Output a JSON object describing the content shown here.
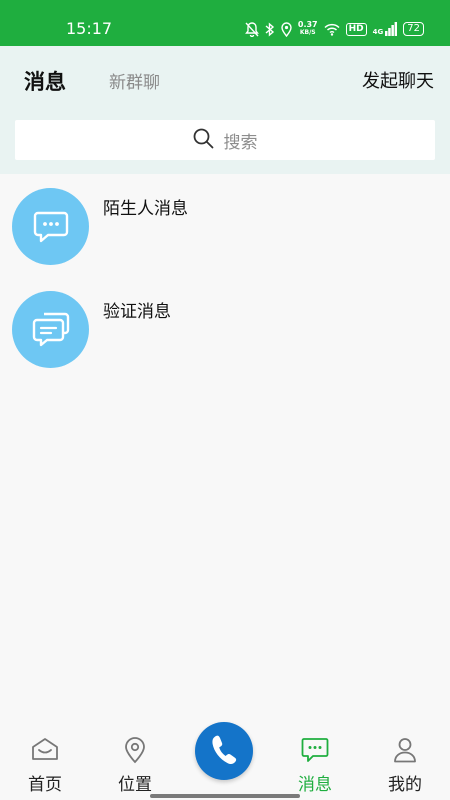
{
  "status_bar": {
    "time": "15:17",
    "speed_value": "0.37",
    "speed_unit": "KB/S",
    "hd": "HD",
    "signal": "4G",
    "battery": "72",
    "bg_color": "#1fae3f"
  },
  "header": {
    "tab_active": "消息",
    "tab_inactive": "新群聊",
    "start_chat": "发起聊天",
    "bg_color": "#e9f3f2"
  },
  "search": {
    "placeholder": "搜索",
    "icon": "search-icon"
  },
  "messages": [
    {
      "title": "陌生人消息",
      "icon": "chat-bubble-icon",
      "avatar_color": "#6ec7f3"
    },
    {
      "title": "验证消息",
      "icon": "double-chat-bubble-icon",
      "avatar_color": "#6ec7f3"
    }
  ],
  "bottom_nav": {
    "items": [
      {
        "label": "首页",
        "icon": "home-icon",
        "active": false
      },
      {
        "label": "位置",
        "icon": "location-pin-icon",
        "active": false
      },
      {
        "label": "消息",
        "icon": "message-icon",
        "active": true
      },
      {
        "label": "我的",
        "icon": "user-icon",
        "active": false
      }
    ],
    "call_icon": "phone-icon",
    "call_color": "#1474c9",
    "active_color": "#1fae3f"
  }
}
